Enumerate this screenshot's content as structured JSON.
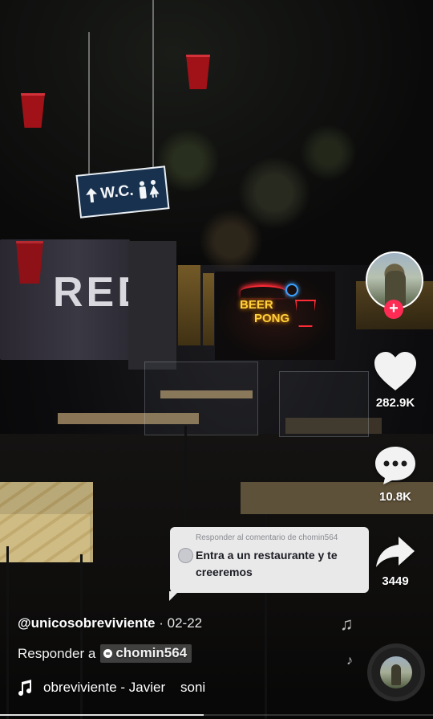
{
  "video": {
    "wc_sign_label": "W.C.",
    "wall_text": "RED",
    "neon_line1": "BEER",
    "neon_line2": "PONG"
  },
  "rail": {
    "likes": "282.9K",
    "comments": "10.8K",
    "shares": "3449",
    "icons": [
      "plus-icon",
      "heart-icon",
      "comment-icon",
      "share-icon"
    ]
  },
  "reply_bubble": {
    "header": "Responder al comentario de chomin564",
    "text": "Entra a un restaurante y te creeremos"
  },
  "info": {
    "username": "@unicosobreviviente",
    "separator": " · ",
    "date": "02-22",
    "reply_prefix": "Responder a",
    "reply_user": "chomin564",
    "music": "obreviviente - Javier    soni"
  },
  "progress": {
    "fraction": 0.47
  },
  "colors": {
    "accent": "#fe2c55",
    "bubble": "#e9e9ea"
  }
}
